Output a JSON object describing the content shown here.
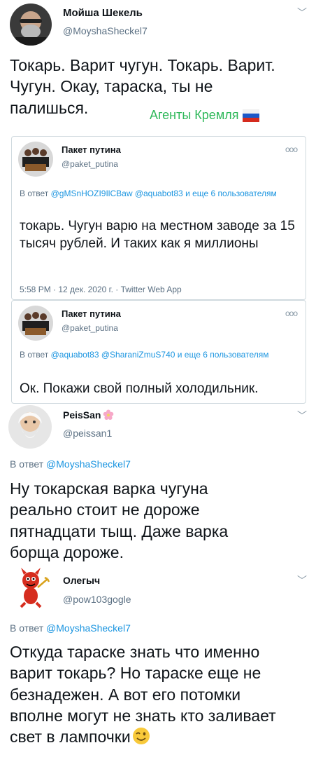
{
  "tweet1": {
    "name": "Мойша Шекель",
    "handle": "@MoyshaSheckel7",
    "text": "Токарь. Варит чугун. Токарь. Варит. Чугун. Окау, тараска, ты не палишься.",
    "tag": "Агенты Кремля"
  },
  "quote1": {
    "name": "Пакет путина",
    "handle": "@paket_putina",
    "reply_prefix": "В ответ",
    "reply_mentions": "@gMSnHOZI9IlCBaw @aquabot83",
    "reply_suffix": "и еще 6 пользователям",
    "text": "токарь. Чугун варю на местном заводе за 15 тысяч рублей. И таких как я миллионы",
    "meta": "5:58 PM · 12 дек. 2020 г. · Twitter Web App"
  },
  "quote2": {
    "name": "Пакет путина",
    "handle": "@paket_putina",
    "reply_prefix": "В ответ",
    "reply_mentions": "@aquabot83 @SharaniZmuS740",
    "reply_suffix": "и еще 6 пользователям",
    "text": "Ок. Покажи свой полный холодильник."
  },
  "tweet2": {
    "name": "PeisSan",
    "handle": "@peissan1",
    "reply_prefix": "В ответ",
    "reply_mention": "@MoyshaSheckel7",
    "text": "Ну токарская варка чугуна реально стоит не дороже пятнадцати тыщ. Даже варка борща дороже."
  },
  "tweet3": {
    "name": "Олегыч",
    "handle": "@pow103gogle",
    "reply_prefix": "В ответ",
    "reply_mention": "@MoyshaSheckel7",
    "text": "Откуда тараске знать что именно варит токарь? Но тараске еще не безнадежен. А вот его потомки вполне могут не знать кто заливает свет в лампочки"
  },
  "icons": {
    "more": "ooo",
    "chevron": "﹀",
    "flag": "russian-flag-icon",
    "emoji_wink": "winking-face-icon",
    "emoji_flower": "cherry-blossom-icon"
  },
  "colors": {
    "text": "#0f1419",
    "secondary": "#5b7083",
    "link": "#1b95e0",
    "tag_green": "#2fb85a",
    "border": "#cfd9de"
  }
}
